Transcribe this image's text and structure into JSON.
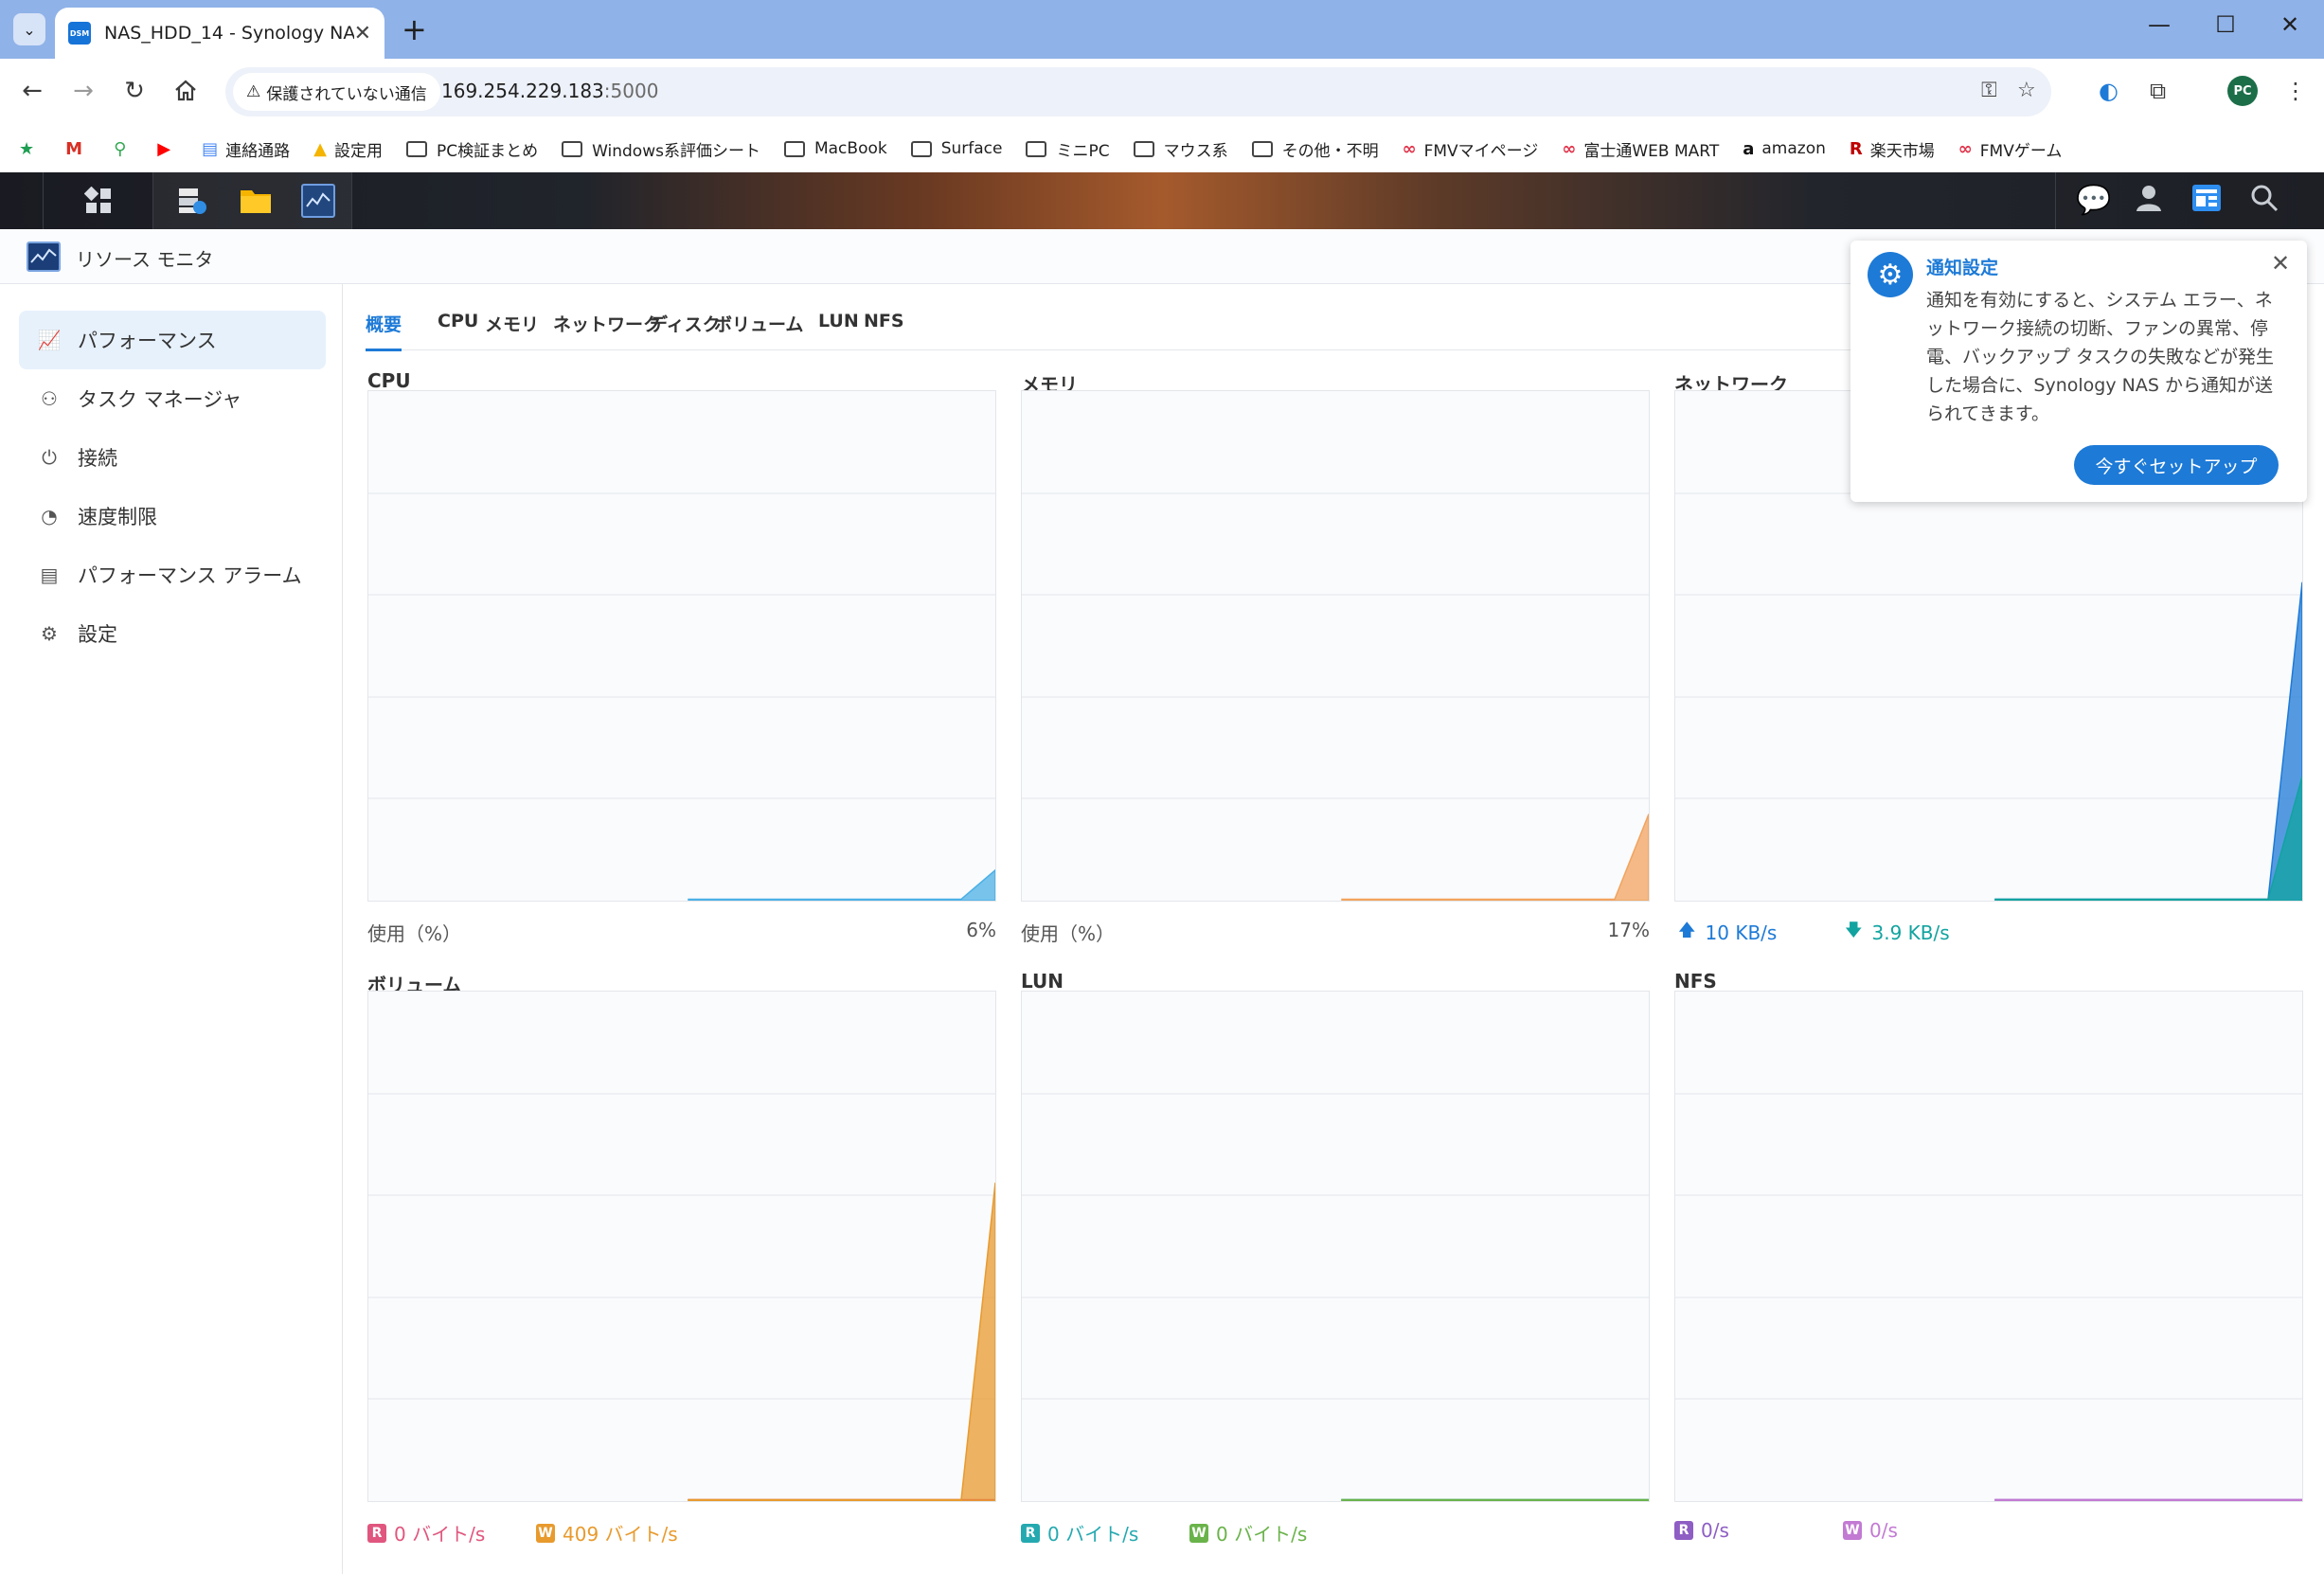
{
  "browser": {
    "tab_title": "NAS_HDD_14 - Synology NAS",
    "favicon_text": "DSM",
    "security_label": "保護されていない通信",
    "url_host": "169.254.229.183",
    "url_port": ":5000",
    "avatar_initials": "PC",
    "bookmarks": [
      {
        "label": "",
        "icon": "star-icon"
      },
      {
        "label": "",
        "icon": "gmail-icon"
      },
      {
        "label": "",
        "icon": "maps-icon"
      },
      {
        "label": "",
        "icon": "youtube-icon"
      },
      {
        "label": "連絡通路",
        "icon": "docs-icon"
      },
      {
        "label": "設定用",
        "icon": "drive-icon"
      },
      {
        "label": "PC検証まとめ",
        "icon": "folder-icon"
      },
      {
        "label": "Windows系評価シート",
        "icon": "folder-icon"
      },
      {
        "label": "MacBook",
        "icon": "folder-icon"
      },
      {
        "label": "Surface",
        "icon": "folder-icon"
      },
      {
        "label": "ミニPC",
        "icon": "folder-icon"
      },
      {
        "label": "マウス系",
        "icon": "folder-icon"
      },
      {
        "label": "その他・不明",
        "icon": "folder-icon"
      },
      {
        "label": "FMVマイページ",
        "icon": "fmv-icon"
      },
      {
        "label": "富士通WEB MART",
        "icon": "fmv-icon"
      },
      {
        "label": "amazon",
        "icon": "amazon-icon"
      },
      {
        "label": "楽天市場",
        "icon": "rakuten-icon"
      },
      {
        "label": "FMVゲーム",
        "icon": "fmv-icon"
      }
    ]
  },
  "window": {
    "title": "リソース モニタ"
  },
  "sidebar": {
    "items": [
      {
        "label": "パフォーマンス",
        "icon": "performance-icon",
        "active": true
      },
      {
        "label": "タスク マネージャ",
        "icon": "task-manager-icon",
        "active": false
      },
      {
        "label": "接続",
        "icon": "plug-icon",
        "active": false
      },
      {
        "label": "速度制限",
        "icon": "speed-gauge-icon",
        "active": false
      },
      {
        "label": "パフォーマンス アラーム",
        "icon": "alarm-list-icon",
        "active": false
      },
      {
        "label": "設定",
        "icon": "gear-icon",
        "active": false
      }
    ]
  },
  "tabs": [
    {
      "label": "概要",
      "active": true
    },
    {
      "label": "CPU",
      "active": false
    },
    {
      "label": "メモリ",
      "active": false
    },
    {
      "label": "ネットワーク",
      "active": false
    },
    {
      "label": "ディスク",
      "active": false
    },
    {
      "label": "ボリューム",
      "active": false
    },
    {
      "label": "LUN",
      "active": false
    },
    {
      "label": "NFS",
      "active": false
    }
  ],
  "panels": {
    "cpu": {
      "title": "CPU",
      "usage_label": "使用（%）",
      "value": "6%"
    },
    "memory": {
      "title": "メモリ",
      "usage_label": "使用（%）",
      "value": "17%"
    },
    "network": {
      "title": "ネットワーク",
      "up": "10 KB/s",
      "down": "3.9 KB/s"
    },
    "volume": {
      "title": "ボリューム",
      "read": "0 バイト/s",
      "write": "409 バイト/s"
    },
    "lun": {
      "title": "LUN",
      "read": "0 バイト/s",
      "write": "0 バイト/s"
    },
    "nfs": {
      "title": "NFS",
      "read": "0/s",
      "write": "0/s"
    }
  },
  "legend_letters": {
    "read": "R",
    "write": "W"
  },
  "colors": {
    "accent": "#1d7ad7",
    "cpu": "#4bb0e6",
    "memory": "#f2a35e",
    "net_up": "#1d7ad7",
    "net_down": "#12a3a0",
    "volume_read": "#e0567e",
    "volume_write": "#e89a2d",
    "lun_read": "#25a9b0",
    "lun_write": "#6ab34a",
    "nfs_read": "#8e5ec4",
    "nfs_write": "#c27ad3"
  },
  "notification": {
    "title": "通知設定",
    "body": "通知を有効にすると、システム エラー、ネットワーク接続の切断、ファンの異常、停電、バックアップ タスクの失敗などが発生した場合に、Synology NAS から通知が送られてきます。",
    "button": "今すぐセットアップ"
  },
  "chart_data": [
    {
      "type": "area",
      "name": "CPU",
      "ylim": [
        0,
        100
      ],
      "values": [
        0,
        0,
        0,
        0,
        0,
        0,
        0,
        0,
        0,
        6
      ],
      "unit": "%"
    },
    {
      "type": "area",
      "name": "メモリ",
      "ylim": [
        0,
        100
      ],
      "values": [
        0,
        0,
        0,
        0,
        0,
        0,
        0,
        0,
        0,
        17
      ],
      "unit": "%"
    },
    {
      "type": "area",
      "name": "ネットワーク",
      "series": [
        {
          "name": "up",
          "values": [
            0,
            0,
            0,
            0,
            0,
            0,
            0,
            0,
            0,
            10
          ]
        },
        {
          "name": "down",
          "values": [
            0,
            0,
            0,
            0,
            0,
            0,
            0,
            0,
            0,
            3.9
          ]
        }
      ],
      "unit": "KB/s"
    },
    {
      "type": "area",
      "name": "ボリューム",
      "series": [
        {
          "name": "read",
          "values": [
            0,
            0,
            0,
            0,
            0,
            0,
            0,
            0,
            0,
            0
          ]
        },
        {
          "name": "write",
          "values": [
            0,
            0,
            0,
            0,
            0,
            0,
            0,
            0,
            0,
            409
          ]
        }
      ],
      "unit": "バイト/s"
    },
    {
      "type": "area",
      "name": "LUN",
      "series": [
        {
          "name": "read",
          "values": [
            0,
            0,
            0,
            0,
            0,
            0,
            0,
            0,
            0,
            0
          ]
        },
        {
          "name": "write",
          "values": [
            0,
            0,
            0,
            0,
            0,
            0,
            0,
            0,
            0,
            0
          ]
        }
      ],
      "unit": "バイト/s"
    },
    {
      "type": "area",
      "name": "NFS",
      "series": [
        {
          "name": "read",
          "values": [
            0,
            0,
            0,
            0,
            0,
            0,
            0,
            0,
            0,
            0
          ]
        },
        {
          "name": "write",
          "values": [
            0,
            0,
            0,
            0,
            0,
            0,
            0,
            0,
            0,
            0
          ]
        }
      ],
      "unit": "/s"
    }
  ]
}
